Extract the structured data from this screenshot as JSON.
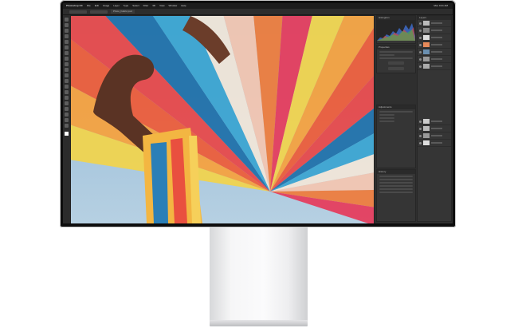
{
  "menubar": {
    "app_name": "Photoshop CC",
    "items": [
      "File",
      "Edit",
      "Image",
      "Layer",
      "Type",
      "Select",
      "Filter",
      "3D",
      "View",
      "Window",
      "Help"
    ],
    "clock": "Mon 9:41 AM"
  },
  "options_bar": {
    "document_tab": "Photo_Fabric.psd"
  },
  "panels": {
    "histogram": "Histogram",
    "properties": "Properties",
    "adjustments": "Adjustments",
    "history": "History",
    "layers": "Layers"
  },
  "colors": {
    "sky": "#9dbfd9",
    "fabric": [
      "#f2d44a",
      "#f6a13c",
      "#ee5a36",
      "#e84547",
      "#1d6fa8",
      "#3aa4d0",
      "#f2e6d8",
      "#f4c6b0",
      "#ef7b3a",
      "#e63a5a"
    ]
  }
}
